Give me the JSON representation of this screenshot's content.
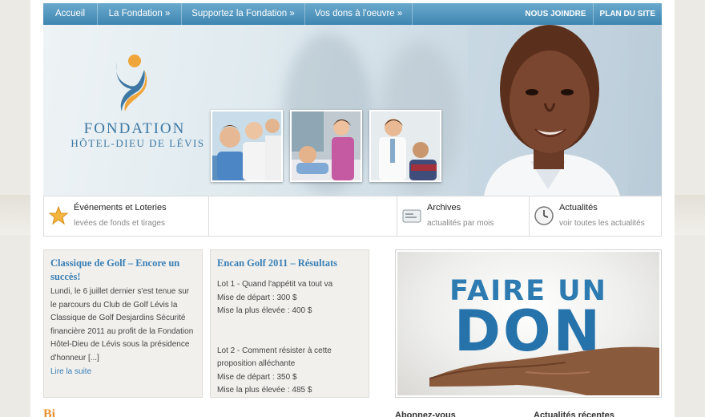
{
  "nav": {
    "items": [
      "Accueil",
      "La Fondation »",
      "Supportez la Fondation »",
      "Vos dons à l'oeuvre »"
    ],
    "right_items": [
      "NOUS JOINDRE",
      "PLAN DU SITE"
    ]
  },
  "logo": {
    "line1": "FONDATION",
    "line2": "HÔTEL-DIEU DE LÉVIS"
  },
  "features": [
    {
      "title": "Événements et Loteries",
      "subtitle": "levées de fonds et tirages",
      "icon": "star-icon"
    },
    {
      "title": "",
      "subtitle": "",
      "icon": ""
    },
    {
      "title": "Archives",
      "subtitle": "actualités par mois",
      "icon": "archive-icon"
    },
    {
      "title": "Actualités",
      "subtitle": "voir toutes les actualités",
      "icon": "clock-icon"
    }
  ],
  "news": [
    {
      "title": "Classique de Golf – Encore un succès!",
      "body": "Lundi, le 6 juillet dernier s'est tenue sur le parcours du Club de Golf Lévis la Classique de Golf Desjardins Sécurité financière 2011 au profit de la Fondation Hôtel-Dieu de Lévis sous la présidence d'honneur [...]",
      "more": "Lire la suite"
    },
    {
      "title": "Encan Golf 2011 – Résultats",
      "lines": [
        "Lot 1 - Quand l'appétit va tout va",
        "Mise de départ : 300 $",
        "Mise la plus élevée : 400 $",
        "",
        "Lot 2 - Comment résister à cette proposition alléchante",
        "Mise de départ : 350 $",
        "Mise la plus élevée : 485 $"
      ]
    }
  ],
  "donate": {
    "line1": "FAIRE UN",
    "line2": "DON"
  },
  "bottom": {
    "left_partial": "Bi",
    "mid": "Abonnez-vous",
    "right": "Actualités récentes"
  },
  "colors": {
    "nav": "#4a8fba",
    "accent": "#3a7fb5",
    "logo_orange": "#f0a53a"
  }
}
